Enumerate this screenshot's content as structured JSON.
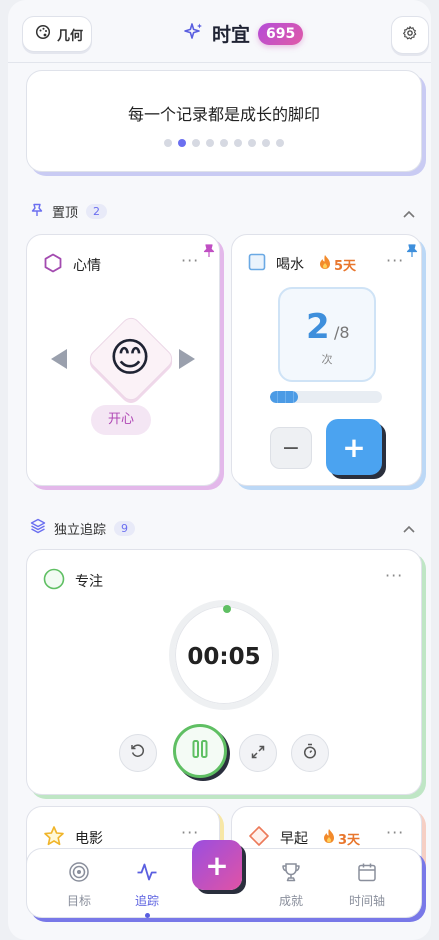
{
  "header": {
    "theme_label": "几何",
    "app_title": "时宜",
    "score": "695"
  },
  "quote": {
    "text": "每一个记录都是成长的脚印",
    "page_count": 9,
    "active_page": 1
  },
  "pinned_section": {
    "label": "置顶",
    "count": "2"
  },
  "mood_card": {
    "title": "心情",
    "emoji": "😊",
    "mood": "开心",
    "more": "···"
  },
  "water_card": {
    "title": "喝水",
    "streak": "5天",
    "current": "2",
    "target": "/8",
    "unit": "次",
    "progress": 0.25,
    "minus": "−",
    "plus": "+",
    "more": "···"
  },
  "tracking_section": {
    "label": "独立追踪",
    "count": "9"
  },
  "focus_card": {
    "title": "专注",
    "timer": "00:05",
    "more": "···"
  },
  "movie_card": {
    "title": "电影",
    "more": "···"
  },
  "early_card": {
    "title": "早起",
    "streak": "3天",
    "more": "···"
  },
  "nav": {
    "items": [
      {
        "label": "目标",
        "icon": "target-icon"
      },
      {
        "label": "追踪",
        "icon": "pulse-icon"
      },
      {
        "label": "成就",
        "icon": "trophy-icon"
      },
      {
        "label": "时间轴",
        "icon": "calendar-icon"
      }
    ],
    "active_index": 1,
    "fab_label": "+"
  },
  "colors": {
    "accent": "#6b6ff0",
    "water_blue": "#4ba3f0",
    "focus_green": "#5fbf63",
    "mood_purple": "#b048b5",
    "streak_orange": "#e8762d"
  }
}
